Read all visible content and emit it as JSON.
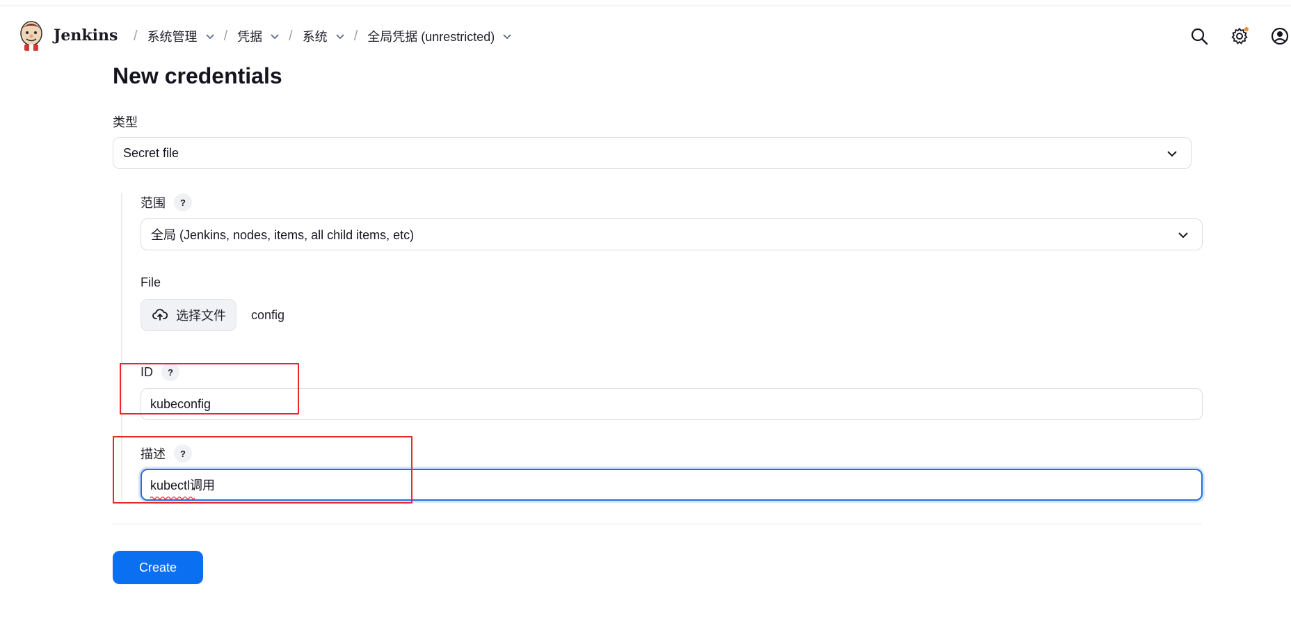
{
  "header": {
    "brand": "Jenkins",
    "breadcrumbs": [
      {
        "label": "系统管理"
      },
      {
        "label": "凭据"
      },
      {
        "label": "系统"
      },
      {
        "label": "全局凭据 (unrestricted)"
      }
    ],
    "icons": [
      "search-icon",
      "gear-icon",
      "user-icon"
    ],
    "notification_dot_color": "#f08c2e"
  },
  "page": {
    "title": "New credentials"
  },
  "form": {
    "type_label": "类型",
    "type_value": "Secret file",
    "scope_label": "范围",
    "scope_value": "全局 (Jenkins, nodes, items, all child items, etc)",
    "file_label": "File",
    "file_button": "选择文件",
    "file_name": "config",
    "id_label": "ID",
    "id_value": "kubeconfig",
    "desc_label": "描述",
    "desc_value": "kubectl调用",
    "help_glyph": "?",
    "create_label": "Create"
  },
  "colors": {
    "accent": "#0b6ff2",
    "highlight_box": "#e8262b",
    "focus_border": "#1f6fe0"
  }
}
